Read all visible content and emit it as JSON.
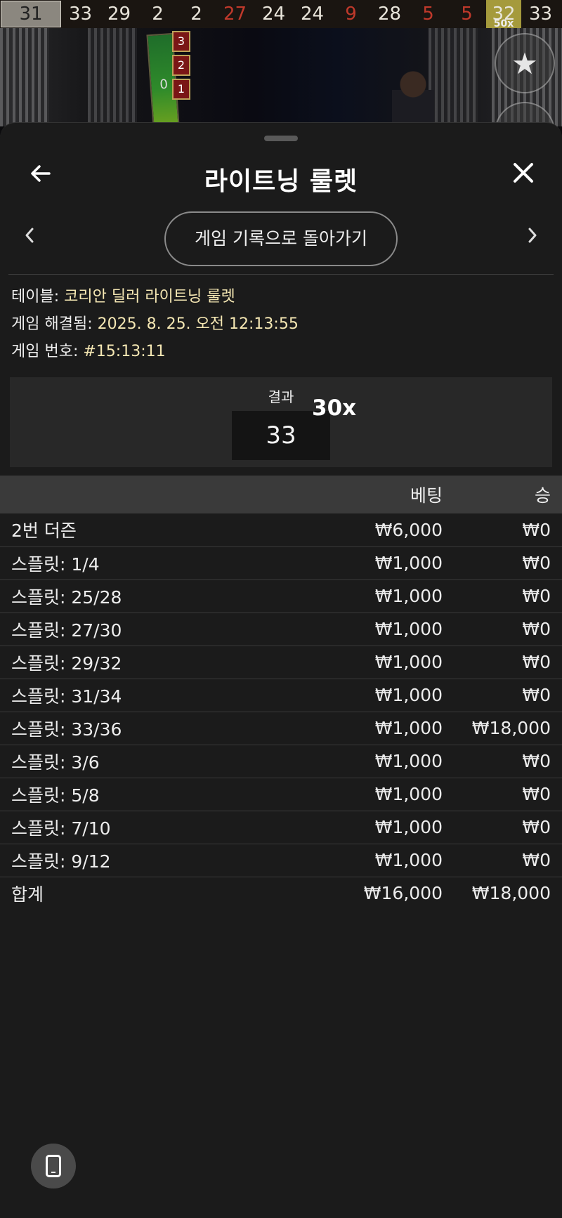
{
  "recent_numbers": [
    {
      "value": "31",
      "color": "#222222",
      "style": "highlight"
    },
    {
      "value": "33",
      "color": "#e8e4da"
    },
    {
      "value": "29",
      "color": "#e8e4da"
    },
    {
      "value": "2",
      "color": "#e8e4da"
    },
    {
      "value": "2",
      "color": "#e8e4da"
    },
    {
      "value": "27",
      "color": "#c0392b"
    },
    {
      "value": "24",
      "color": "#e8e4da"
    },
    {
      "value": "24",
      "color": "#e8e4da"
    },
    {
      "value": "9",
      "color": "#c0392b"
    },
    {
      "value": "28",
      "color": "#e8e4da"
    },
    {
      "value": "5",
      "color": "#c0392b"
    },
    {
      "value": "5",
      "color": "#c0392b"
    },
    {
      "value": "32",
      "color": "#e8e6dc",
      "style": "gold",
      "multiplier": "50x"
    },
    {
      "value": "33",
      "color": "#e8e4da"
    }
  ],
  "video": {
    "strip_zero": "0",
    "tiles": [
      "3",
      "2",
      "1"
    ]
  },
  "icons": {
    "back": "arrow-left-icon",
    "close": "close-icon",
    "prev": "chevron-left-icon",
    "next": "chevron-right-icon",
    "favorite": "star-icon",
    "device": "phone-icon"
  },
  "header": {
    "title": "라이트닝 룰렛"
  },
  "nav": {
    "history_button": "게임 기록으로 돌아가기"
  },
  "info": {
    "table_label": "테이블:",
    "table_value": "코리안 딜러 라이트닝 룰렛",
    "resolved_label": "게임 해결됨:",
    "resolved_value": "2025. 8. 25. 오전 12:13:55",
    "game_no_label": "게임 번호:",
    "game_no_value": "#15:13:11"
  },
  "result": {
    "label": "결과",
    "number": "33",
    "multiplier": "30x"
  },
  "bets_table": {
    "headers": {
      "name": "",
      "bet": "베팅",
      "win": "승"
    },
    "rows": [
      {
        "name": "2번 더즌",
        "bet": "₩6,000",
        "win": "₩0"
      },
      {
        "name": "스플릿: 1/4",
        "bet": "₩1,000",
        "win": "₩0"
      },
      {
        "name": "스플릿: 25/28",
        "bet": "₩1,000",
        "win": "₩0"
      },
      {
        "name": "스플릿: 27/30",
        "bet": "₩1,000",
        "win": "₩0"
      },
      {
        "name": "스플릿: 29/32",
        "bet": "₩1,000",
        "win": "₩0"
      },
      {
        "name": "스플릿: 31/34",
        "bet": "₩1,000",
        "win": "₩0"
      },
      {
        "name": "스플릿: 33/36",
        "bet": "₩1,000",
        "win": "₩18,000"
      },
      {
        "name": "스플릿: 3/6",
        "bet": "₩1,000",
        "win": "₩0"
      },
      {
        "name": "스플릿: 5/8",
        "bet": "₩1,000",
        "win": "₩0"
      },
      {
        "name": "스플릿: 7/10",
        "bet": "₩1,000",
        "win": "₩0"
      },
      {
        "name": "스플릿: 9/12",
        "bet": "₩1,000",
        "win": "₩0"
      }
    ],
    "total": {
      "name": "합계",
      "bet": "₩16,000",
      "win": "₩18,000"
    }
  },
  "colors": {
    "sheet_bg": "#1b1b1b",
    "accent_text": "#f5e7b3",
    "red_number": "#c0392b",
    "gold_cell": "#a59a3c"
  }
}
